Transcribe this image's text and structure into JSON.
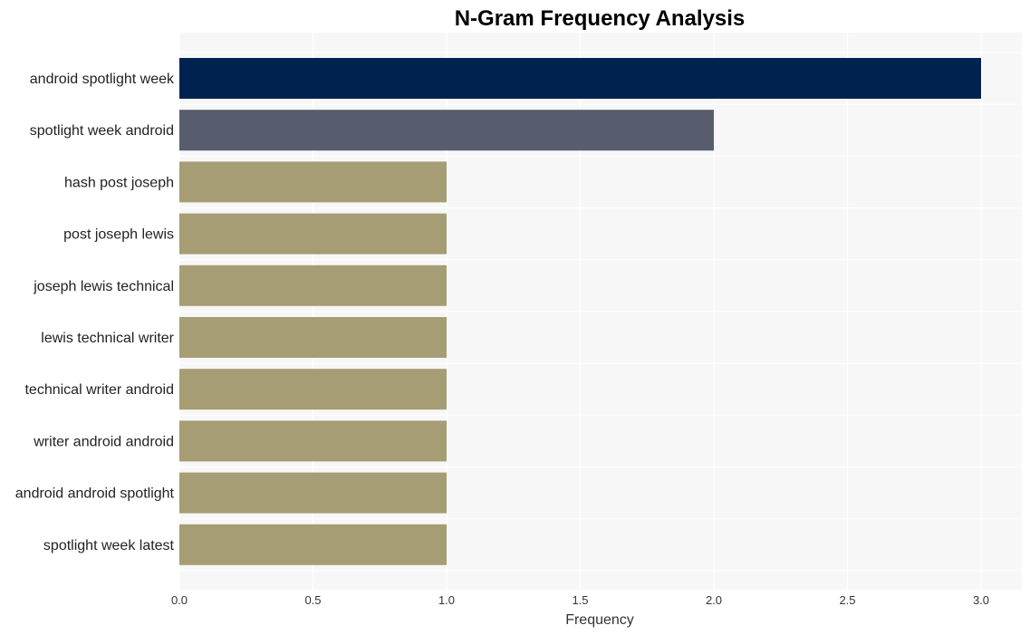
{
  "chart_data": {
    "type": "bar",
    "orientation": "horizontal",
    "title": "N-Gram Frequency Analysis",
    "xlabel": "Frequency",
    "ylabel": "",
    "categories": [
      "android spotlight week",
      "spotlight week android",
      "hash post joseph",
      "post joseph lewis",
      "joseph lewis technical",
      "lewis technical writer",
      "technical writer android",
      "writer android android",
      "android android spotlight",
      "spotlight week latest"
    ],
    "values": [
      3,
      2,
      1,
      1,
      1,
      1,
      1,
      1,
      1,
      1
    ],
    "bar_colors": [
      "#00224e",
      "#575d6d",
      "#a69d75",
      "#a69d75",
      "#a69d75",
      "#a69d75",
      "#a69d75",
      "#a69d75",
      "#a69d75",
      "#a69d75"
    ],
    "xlim": [
      0,
      3.15
    ],
    "xticks": [
      0,
      0.5,
      1.0,
      1.5,
      2.0,
      2.5,
      3.0
    ],
    "xtick_labels": [
      "0.0",
      "0.5",
      "1.0",
      "1.5",
      "2.0",
      "2.5",
      "3.0"
    ],
    "grid": true,
    "legend": "none",
    "plot_background": "#f7f7f7"
  }
}
